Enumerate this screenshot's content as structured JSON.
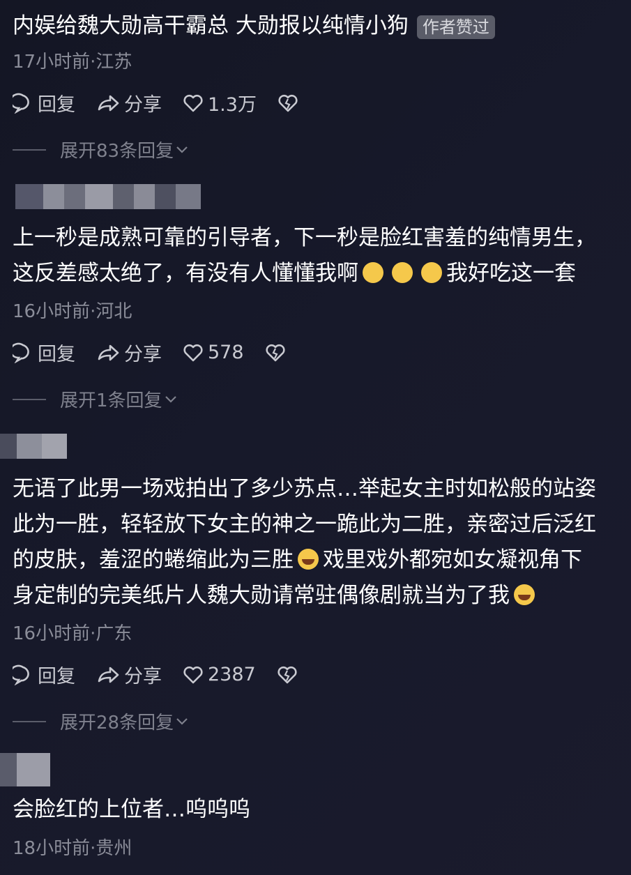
{
  "comments": [
    {
      "text": "内娱给魏大勋高干霸总 大勋报以纯情小狗",
      "badge": "作者赞过",
      "meta": "17小时前·江苏",
      "actions": {
        "reply": "回复",
        "share": "分享",
        "likes": "1.3万"
      },
      "expand": "展开83条回复"
    },
    {
      "lines": [
        "上一秒是成熟可靠的引导者，下一秒是脸红害羞的纯情男生，",
        "这反差感太绝了，有没有人懂懂我啊",
        "我好吃这一套"
      ],
      "meta": "16小时前·河北",
      "actions": {
        "reply": "回复",
        "share": "分享",
        "likes": "578"
      },
      "expand": "展开1条回复"
    },
    {
      "lines": [
        "无语了此男一场戏拍出了多少苏点…举起女主时如松般的站姿",
        "此为一胜，轻轻放下女主的神之一跪此为二胜，亲密过后泛红",
        "的皮肤，羞涩的蜷缩此为三胜",
        "戏里戏外都宛如女凝视角下",
        "身定制的完美纸片人魏大勋请常驻偶像剧就当为了我"
      ],
      "meta": "16小时前·广东",
      "actions": {
        "reply": "回复",
        "share": "分享",
        "likes": "2387"
      },
      "expand": "展开28条回复"
    },
    {
      "text": "会脸红的上位者…呜呜呜",
      "meta": "18小时前·贵州"
    }
  ],
  "icons": {
    "reply": "speech-bubble-icon",
    "share": "share-arrow-icon",
    "like": "heart-icon",
    "dislike": "broken-heart-icon",
    "expand": "chevron-down-icon",
    "emoji_blush": "blushing-face-emoji",
    "emoji_cry": "crying-face-emoji"
  }
}
